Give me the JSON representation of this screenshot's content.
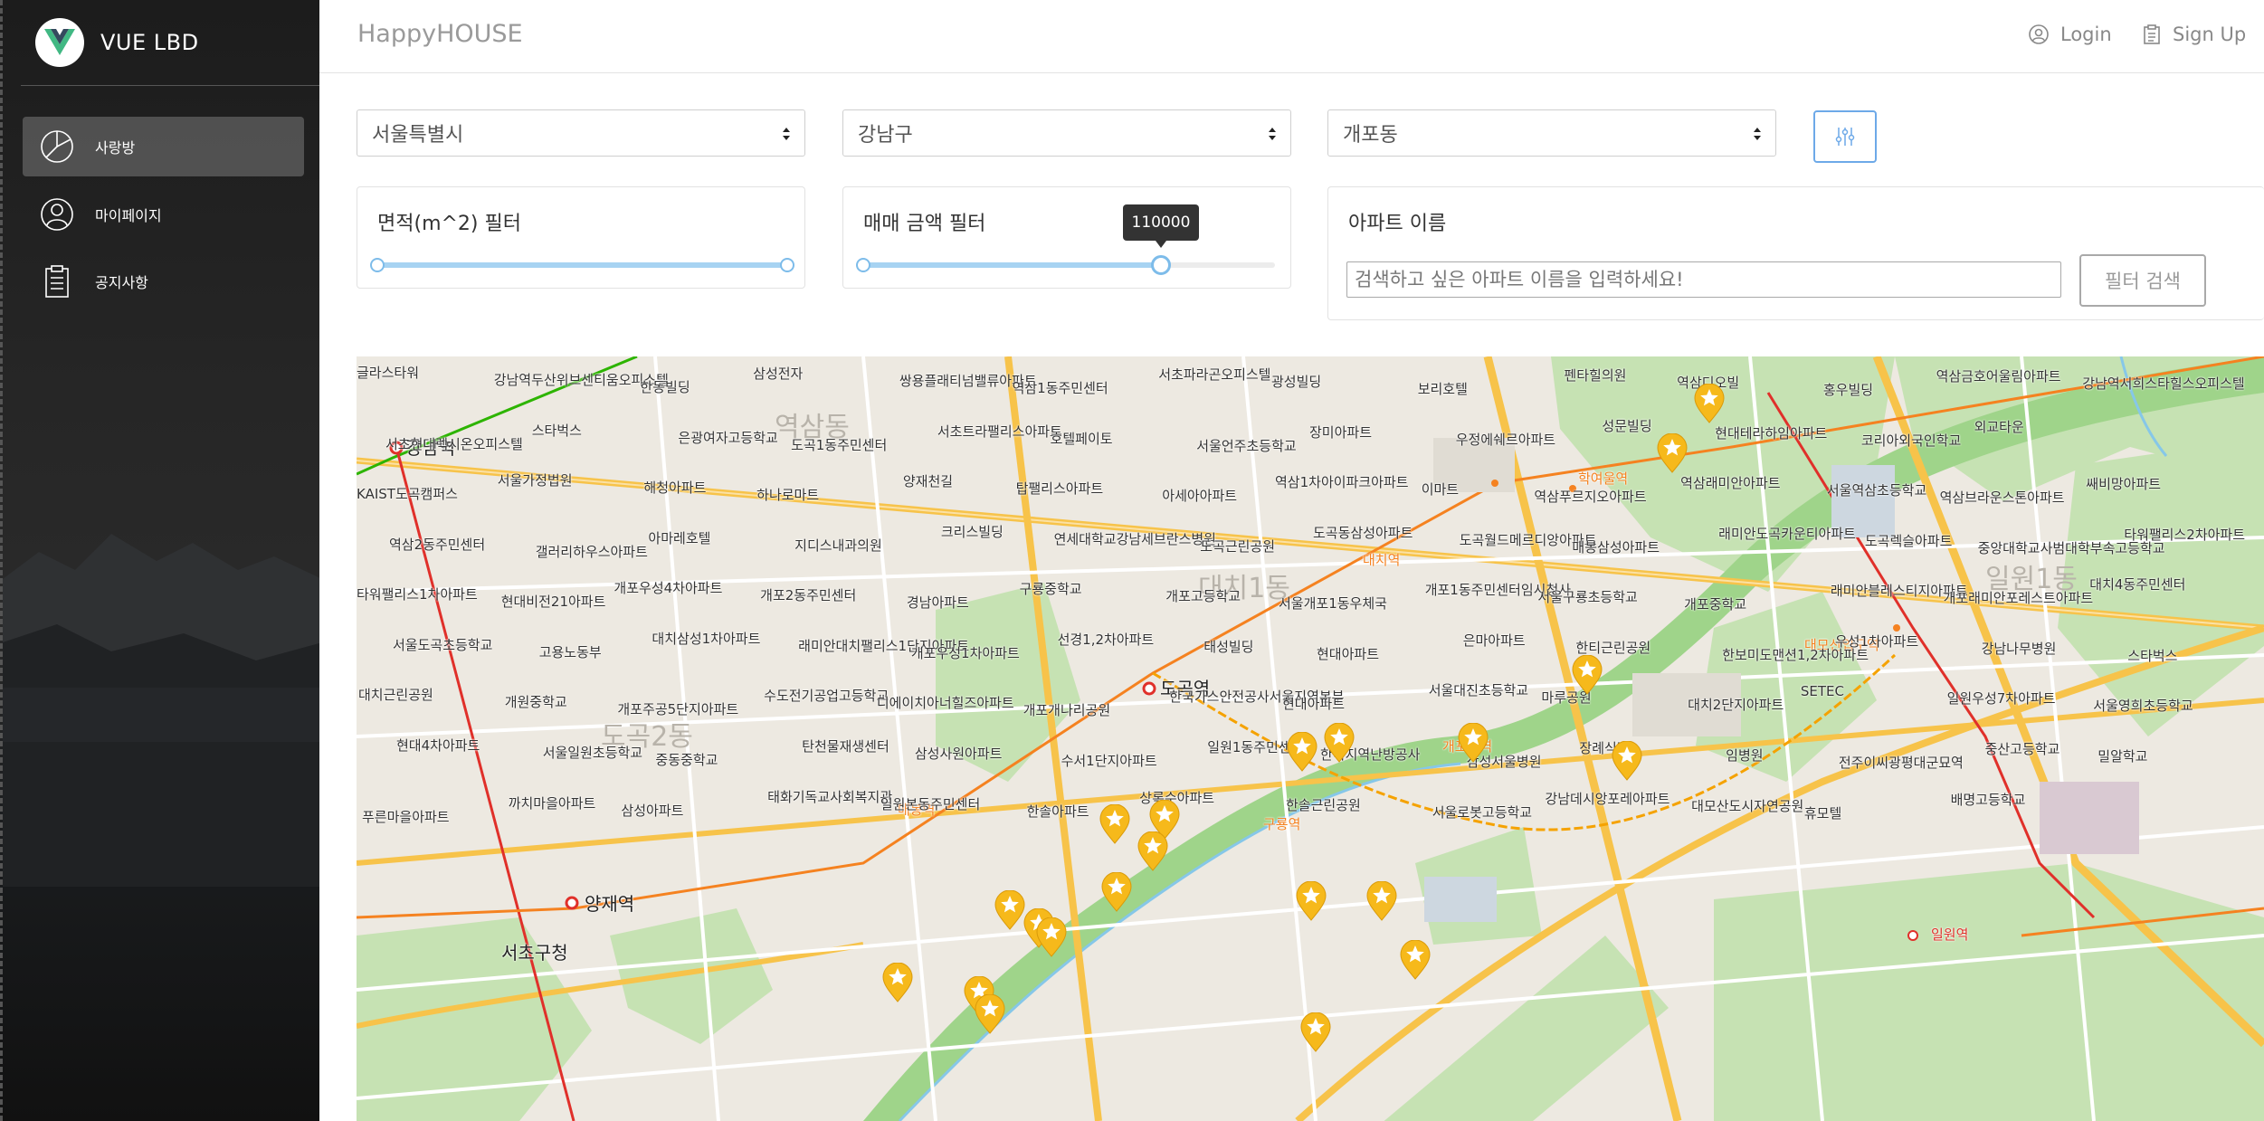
{
  "brand": {
    "title": "VUE LBD"
  },
  "sidebar": {
    "items": [
      {
        "label": "사랑방",
        "icon": "pie-chart-icon",
        "active": true
      },
      {
        "label": "마이페이지",
        "icon": "user-icon",
        "active": false
      },
      {
        "label": "공지사항",
        "icon": "clipboard-icon",
        "active": false
      }
    ]
  },
  "topbar": {
    "title": "HappyHOUSE",
    "login_label": "Login",
    "signup_label": "Sign Up"
  },
  "filters": {
    "city": "서울특별시",
    "district": "강남구",
    "dong": "개포동",
    "area_filter_label": "면적(m^2) 필터",
    "area_range_fraction": [
      0,
      1
    ],
    "price_filter_label": "매매 금액 필터",
    "price_value": "110000",
    "price_range_fraction": [
      0,
      0.74
    ],
    "apt_name_label": "아파트 이름",
    "apt_name_placeholder": "검색하고 싶은 아파트 이름을 입력하세요!",
    "search_button_label": "필터 검색"
  },
  "colors": {
    "slider_active": "#a7d3f2",
    "slider_handle": "#7dbcea",
    "filter_button_border": "#6da9e8",
    "marker": "#f6b91b",
    "map_green": "#c6e2b3",
    "road_yellow": "#f7c34a"
  },
  "map": {
    "districts": [
      "역삼동",
      "대치1동",
      "일원1동",
      "도곡2동"
    ],
    "stations": [
      "강남역",
      "도곡역",
      "양재역",
      "대치역",
      "학여울역",
      "매봉역",
      "구룡역",
      "개포동역",
      "대모산입구역",
      "일원역"
    ],
    "labels": [
      "글라스타워",
      "강남역두산위브센티움오피스텔",
      "한동빌딩",
      "삼성전자",
      "쌍용플래티넘밸류아파트",
      "역삼1동주민센터",
      "서초파라곤오피스텔",
      "광성빌딩",
      "보리호텔",
      "펜타힐의원",
      "역삼디오빌",
      "홍우빌딩",
      "역삼금호어울림아파트",
      "강남역서희스타힐스오피스텔",
      "서초현대렉시온오피스텔",
      "스타벅스",
      "은광여자고등학교",
      "도곡1동주민센터",
      "서초트라팰리스아파트",
      "호텔페이토",
      "서울언주초등학교",
      "장미아파트",
      "우정에쉐르아파트",
      "성문빌딩",
      "현대테라하임아파트",
      "코리아외국인학교",
      "외교타운",
      "서초구청",
      "KAIST도곡캠퍼스",
      "서울가정법원",
      "해청아파트",
      "하나로마트",
      "양재천길",
      "탑팰리스아파트",
      "아세아아파트",
      "역삼1차아이파크아파트",
      "이마트",
      "역삼푸르지오아파트",
      "역삼래미안아파트",
      "서울역삼초등학교",
      "역삼브라운스톤아파트",
      "쌔비망아파트",
      "역삼2동주민센터",
      "갤러리하우스아파트",
      "아마레호텔",
      "지디스내과의원",
      "크리스빌딩",
      "연세대학교강남세브란스병원",
      "도곡근린공원",
      "도곡동삼성아파트",
      "도곡월드메르디앙아파트",
      "매봉삼성아파트",
      "래미안도곡카운티아파트",
      "도곡렉슬아파트",
      "중앙대학교사범대학부속고등학교",
      "타워팰리스2차아파트",
      "타워팰리스1차아파트",
      "현대비전21아파트",
      "개포우성4차아파트",
      "개포2동주민센터",
      "경남아파트",
      "구룡중학교",
      "개포고등학교",
      "서울개포1동우체국",
      "개포1동주민센터임시청사",
      "서울구룡초등학교",
      "개포중학교",
      "래미안블레스티지아파트",
      "개포래미안포레스트아파트",
      "대치4동주민센터",
      "서울도곡초등학교",
      "고용노동부",
      "대치삼성1차아파트",
      "래미안대치팰리스1단지아파트",
      "개포우성1차아파트",
      "선경1,2차아파트",
      "태성빌딩",
      "현대아파트",
      "은마아파트",
      "한티근린공원",
      "한보미도맨션1,2차아파트",
      "우성1차아파트",
      "강남나무병원",
      "스타벅스",
      "대치근린공원",
      "개원중학교",
      "개포주공5단지아파트",
      "수도전기공업고등학교",
      "디에이치아너힐즈아파트",
      "개포개나리공원",
      "한국가스안전공사서울지역본부",
      "현대아파트",
      "서울대진초등학교",
      "마루공원",
      "대치2단지아파트",
      "SETEC",
      "일원우성7차아파트",
      "서울영희초등학교",
      "현대4차아파트",
      "서울일원초등학교",
      "중동중학교",
      "탄천물재생센터",
      "삼성사원아파트",
      "수서1단지아파트",
      "일원1동주민센터",
      "한국지역난방공사",
      "삼성서울병원",
      "장례식장",
      "임병원",
      "전주이씨광평대군묘역",
      "중산고등학교",
      "밀알학교",
      "푸른마을아파트",
      "까치마을아파트",
      "삼성아파트",
      "태화기독교사회복지관",
      "일원본동주민센터",
      "한솔아파트",
      "상록수아파트",
      "한솔근린공원",
      "서울로봇고등학교",
      "강남데시앙포레아파트",
      "대모산도시자연공원",
      "휴모텔",
      "배명고등학교"
    ]
  }
}
